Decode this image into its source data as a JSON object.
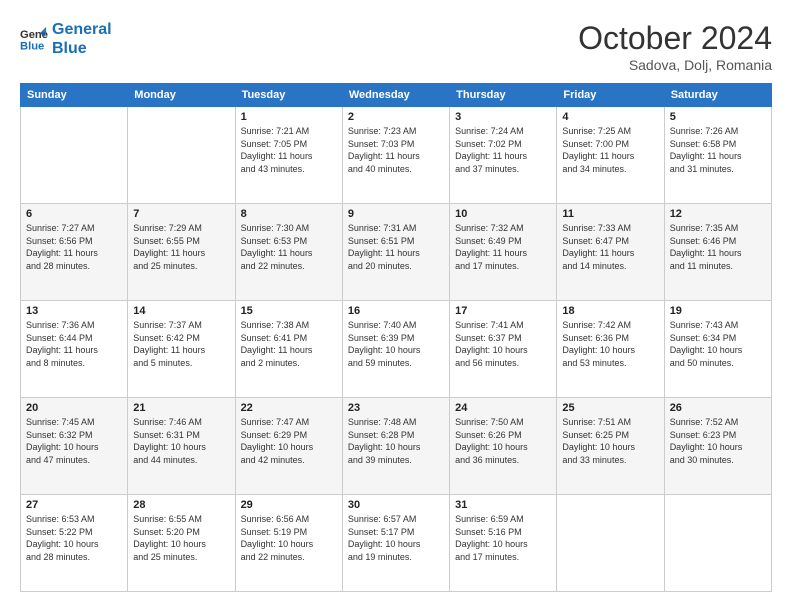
{
  "logo": {
    "line1": "General",
    "line2": "Blue"
  },
  "title": "October 2024",
  "subtitle": "Sadova, Dolj, Romania",
  "weekdays": [
    "Sunday",
    "Monday",
    "Tuesday",
    "Wednesday",
    "Thursday",
    "Friday",
    "Saturday"
  ],
  "weeks": [
    [
      {
        "day": "",
        "info": ""
      },
      {
        "day": "",
        "info": ""
      },
      {
        "day": "1",
        "info": "Sunrise: 7:21 AM\nSunset: 7:05 PM\nDaylight: 11 hours\nand 43 minutes."
      },
      {
        "day": "2",
        "info": "Sunrise: 7:23 AM\nSunset: 7:03 PM\nDaylight: 11 hours\nand 40 minutes."
      },
      {
        "day": "3",
        "info": "Sunrise: 7:24 AM\nSunset: 7:02 PM\nDaylight: 11 hours\nand 37 minutes."
      },
      {
        "day": "4",
        "info": "Sunrise: 7:25 AM\nSunset: 7:00 PM\nDaylight: 11 hours\nand 34 minutes."
      },
      {
        "day": "5",
        "info": "Sunrise: 7:26 AM\nSunset: 6:58 PM\nDaylight: 11 hours\nand 31 minutes."
      }
    ],
    [
      {
        "day": "6",
        "info": "Sunrise: 7:27 AM\nSunset: 6:56 PM\nDaylight: 11 hours\nand 28 minutes."
      },
      {
        "day": "7",
        "info": "Sunrise: 7:29 AM\nSunset: 6:55 PM\nDaylight: 11 hours\nand 25 minutes."
      },
      {
        "day": "8",
        "info": "Sunrise: 7:30 AM\nSunset: 6:53 PM\nDaylight: 11 hours\nand 22 minutes."
      },
      {
        "day": "9",
        "info": "Sunrise: 7:31 AM\nSunset: 6:51 PM\nDaylight: 11 hours\nand 20 minutes."
      },
      {
        "day": "10",
        "info": "Sunrise: 7:32 AM\nSunset: 6:49 PM\nDaylight: 11 hours\nand 17 minutes."
      },
      {
        "day": "11",
        "info": "Sunrise: 7:33 AM\nSunset: 6:47 PM\nDaylight: 11 hours\nand 14 minutes."
      },
      {
        "day": "12",
        "info": "Sunrise: 7:35 AM\nSunset: 6:46 PM\nDaylight: 11 hours\nand 11 minutes."
      }
    ],
    [
      {
        "day": "13",
        "info": "Sunrise: 7:36 AM\nSunset: 6:44 PM\nDaylight: 11 hours\nand 8 minutes."
      },
      {
        "day": "14",
        "info": "Sunrise: 7:37 AM\nSunset: 6:42 PM\nDaylight: 11 hours\nand 5 minutes."
      },
      {
        "day": "15",
        "info": "Sunrise: 7:38 AM\nSunset: 6:41 PM\nDaylight: 11 hours\nand 2 minutes."
      },
      {
        "day": "16",
        "info": "Sunrise: 7:40 AM\nSunset: 6:39 PM\nDaylight: 10 hours\nand 59 minutes."
      },
      {
        "day": "17",
        "info": "Sunrise: 7:41 AM\nSunset: 6:37 PM\nDaylight: 10 hours\nand 56 minutes."
      },
      {
        "day": "18",
        "info": "Sunrise: 7:42 AM\nSunset: 6:36 PM\nDaylight: 10 hours\nand 53 minutes."
      },
      {
        "day": "19",
        "info": "Sunrise: 7:43 AM\nSunset: 6:34 PM\nDaylight: 10 hours\nand 50 minutes."
      }
    ],
    [
      {
        "day": "20",
        "info": "Sunrise: 7:45 AM\nSunset: 6:32 PM\nDaylight: 10 hours\nand 47 minutes."
      },
      {
        "day": "21",
        "info": "Sunrise: 7:46 AM\nSunset: 6:31 PM\nDaylight: 10 hours\nand 44 minutes."
      },
      {
        "day": "22",
        "info": "Sunrise: 7:47 AM\nSunset: 6:29 PM\nDaylight: 10 hours\nand 42 minutes."
      },
      {
        "day": "23",
        "info": "Sunrise: 7:48 AM\nSunset: 6:28 PM\nDaylight: 10 hours\nand 39 minutes."
      },
      {
        "day": "24",
        "info": "Sunrise: 7:50 AM\nSunset: 6:26 PM\nDaylight: 10 hours\nand 36 minutes."
      },
      {
        "day": "25",
        "info": "Sunrise: 7:51 AM\nSunset: 6:25 PM\nDaylight: 10 hours\nand 33 minutes."
      },
      {
        "day": "26",
        "info": "Sunrise: 7:52 AM\nSunset: 6:23 PM\nDaylight: 10 hours\nand 30 minutes."
      }
    ],
    [
      {
        "day": "27",
        "info": "Sunrise: 6:53 AM\nSunset: 5:22 PM\nDaylight: 10 hours\nand 28 minutes."
      },
      {
        "day": "28",
        "info": "Sunrise: 6:55 AM\nSunset: 5:20 PM\nDaylight: 10 hours\nand 25 minutes."
      },
      {
        "day": "29",
        "info": "Sunrise: 6:56 AM\nSunset: 5:19 PM\nDaylight: 10 hours\nand 22 minutes."
      },
      {
        "day": "30",
        "info": "Sunrise: 6:57 AM\nSunset: 5:17 PM\nDaylight: 10 hours\nand 19 minutes."
      },
      {
        "day": "31",
        "info": "Sunrise: 6:59 AM\nSunset: 5:16 PM\nDaylight: 10 hours\nand 17 minutes."
      },
      {
        "day": "",
        "info": ""
      },
      {
        "day": "",
        "info": ""
      }
    ]
  ]
}
